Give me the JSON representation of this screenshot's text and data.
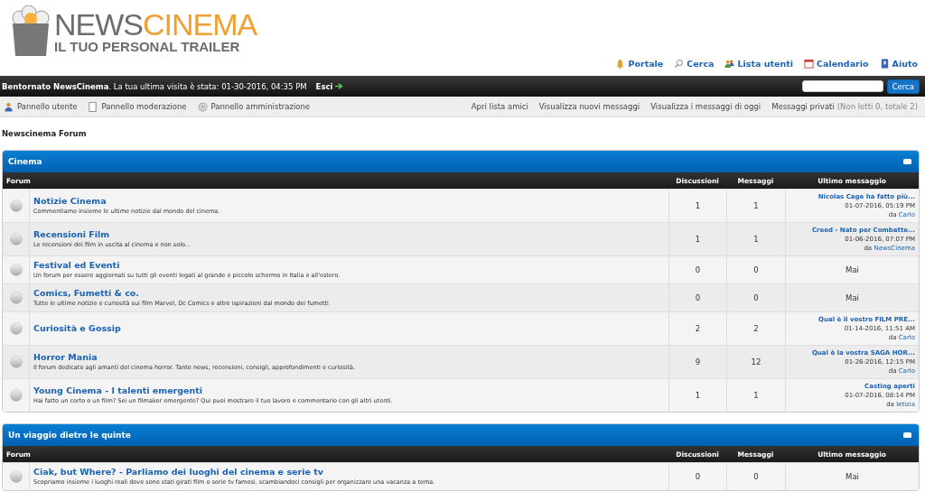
{
  "logo": {
    "word_1": "NEWS",
    "word_2": "CINEMA",
    "tagline": "IL TUO PERSONAL TRAILER"
  },
  "top_links": [
    {
      "label": "Portale",
      "kind": "bell"
    },
    {
      "label": "Cerca",
      "kind": "search"
    },
    {
      "label": "Lista utenti",
      "kind": "users"
    },
    {
      "label": "Calendario",
      "kind": "calendar"
    },
    {
      "label": "Aiuto",
      "kind": "help"
    }
  ],
  "welcome_bar": {
    "text": "**Bentornato NewsCinema**. La tua ultima visita è stata: 01-30-2016, 04:35 PM",
    "logout": "Esci",
    "search_button": "Cerca"
  },
  "tool_bar": {
    "left": [
      {
        "label": "Pannello utente",
        "kind": "user"
      },
      {
        "label": "Pannello moderazione",
        "kind": "page"
      },
      {
        "label": "Pannello amministrazione",
        "kind": "gear"
      }
    ],
    "right": [
      "Apri lista amici",
      "Visualizza nuovi messaggi",
      "Visualizza i messaggi di oggi"
    ],
    "pm_link": "Messaggi privati",
    "pm_count": "(Non letti 0, totale 2)"
  },
  "breadcrumb": "Newscinema Forum",
  "categories": [
    {
      "title": "Cinema",
      "columns": [
        "Forum",
        "Discussioni",
        "Messaggi",
        "Ultimo messaggio"
      ],
      "forums": [
        {
          "name": "Notizie Cinema",
          "description": "Commentiamo insieme le ultime notizie dal mondo del cinema.",
          "threads": "1",
          "posts": "1",
          "last_post": {
            "kind": "post",
            "title": "Nicolas Cage ha fatto più...",
            "date": "01-07-2016, 05:19 PM",
            "by": "da",
            "author": "Carlo"
          }
        },
        {
          "name": "Recensioni Film",
          "description": "Le recensioni dei film in uscita al cinema e non solo...",
          "threads": "1",
          "posts": "1",
          "last_post": {
            "kind": "post",
            "title": "Creed - Nato per Combatte...",
            "date": "01-06-2016, 07:07 PM",
            "by": "da",
            "author": "NewsCinema"
          }
        },
        {
          "name": "Festival ed Eventi",
          "description": "Un forum per essere aggiornati su tutti gli eventi legati al grande e piccolo schermo in Italia e all'estero.",
          "threads": "0",
          "posts": "0",
          "last_post": {
            "kind": "never",
            "text": "Mai"
          }
        },
        {
          "name": "Comics, Fumetti & co.",
          "description": "Tutte le ultime notizie e curiosità sui film Marvel, Dc Comics e altre ispirazioni dal mondo dei fumetti",
          "threads": "0",
          "posts": "0",
          "last_post": {
            "kind": "never",
            "text": "Mai"
          }
        },
        {
          "name": "Curiosità e Gossip",
          "threads": "2",
          "posts": "2",
          "last_post": {
            "kind": "post",
            "title": "Qual è il vostro FILM PRE...",
            "date": "01-14-2016, 11:51 AM",
            "by": "da",
            "author": "Carlo"
          }
        },
        {
          "name": "Horror Mania",
          "description": "Il forum dedicato agli amanti del cinema horror. Tante news, recensioni, consigli, approfondimenti e curiosità.",
          "threads": "9",
          "posts": "12",
          "last_post": {
            "kind": "post",
            "title": "Qual è la vostra SAGA HOR...",
            "date": "01-26-2016, 12:15 PM",
            "by": "da",
            "author": "Carlo"
          }
        },
        {
          "name": "Young Cinema - I talenti emergenti",
          "description": "Hai fatto un corto o un film? Sei un filmaker emergente? Qui puoi mostrare il tuo lavoro e commentario con gli altri utenti.",
          "threads": "1",
          "posts": "1",
          "last_post": {
            "kind": "post",
            "title": "Casting aperti",
            "date": "01-07-2016, 08:14 PM",
            "by": "da",
            "author": "letizia"
          }
        }
      ]
    },
    {
      "title": "Un viaggio dietro le quinte",
      "columns": [
        "Forum",
        "Discussioni",
        "Messaggi",
        "Ultimo messaggio"
      ],
      "forums": [
        {
          "name": "Ciak, but Where? - Parliamo dei luoghi del cinema e serie tv",
          "description": "Scopriamo insieme i luoghi reali dove sono stati girati film o serie tv famosi, scambiandoci consigli per organizzare una vacanza a tema.",
          "threads": "0",
          "posts": "0",
          "last_post": {
            "kind": "never",
            "text": "Mai"
          }
        }
      ]
    }
  ]
}
